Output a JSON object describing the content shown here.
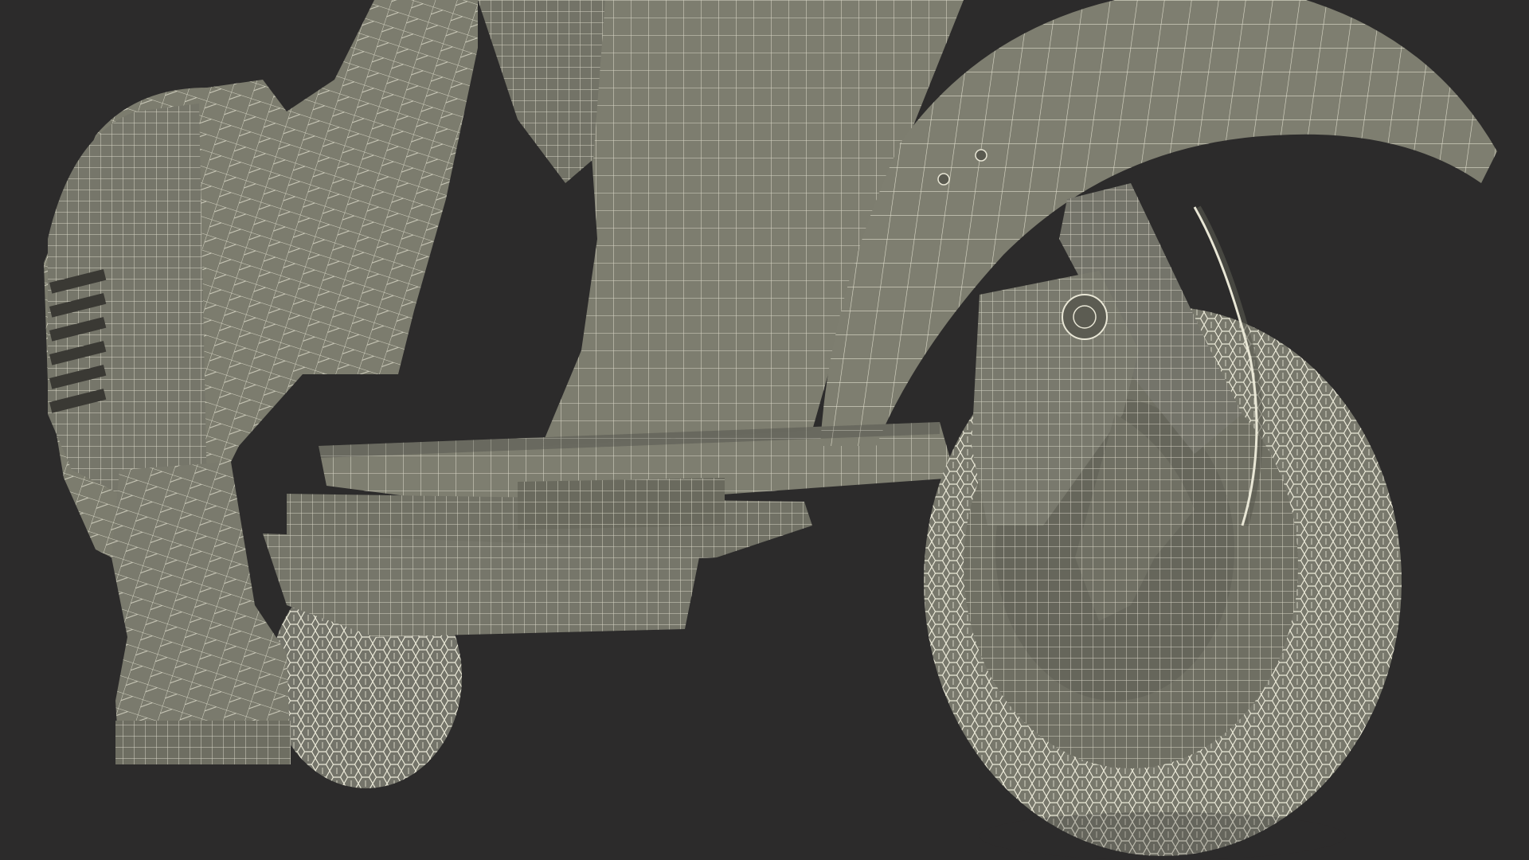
{
  "scene": {
    "subject": "wireframe-scooter-render",
    "colors": {
      "background": "#2c2b2b",
      "surface": "#7c7c6e",
      "surface_dark": "#6b6b5e",
      "surface_light": "#8a8a7b",
      "wire": "#e9e7d6",
      "shadow": "#3c3b36"
    }
  }
}
